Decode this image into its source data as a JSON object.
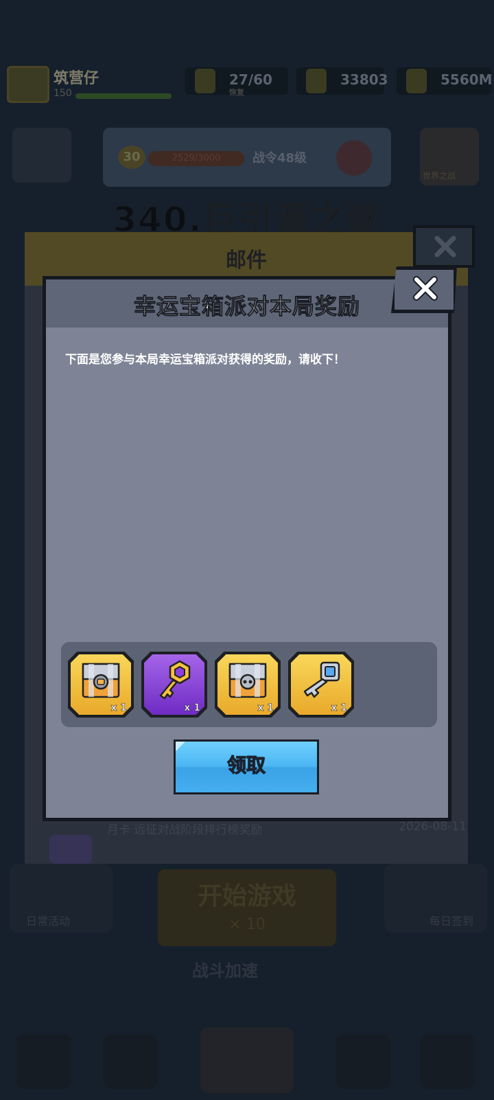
{
  "background": {
    "player_name": "筑营仔",
    "player_level": "150",
    "resources": [
      {
        "icon": "stamina-icon",
        "value": "27/60",
        "sub": "恢复"
      },
      {
        "icon": "gem-icon",
        "value": "33803"
      },
      {
        "icon": "coin-icon",
        "value": "5560M"
      }
    ],
    "banner": {
      "level": "30",
      "progress": "2529/3000",
      "text": "战令48级"
    },
    "side_right_label": "世界之战",
    "stage_title": "340.巨引源之谜",
    "mail": {
      "title": "邮件",
      "row_text": "月卡 远征对战阶段排行榜奖励",
      "row_date": "2026-08-11"
    },
    "bottom": {
      "left_label": "日常活动",
      "right_label": "每日签到",
      "start_label": "开始游戏",
      "start_cost": "× 10",
      "speed_label": "战斗加速"
    }
  },
  "dialog": {
    "title": "幸运宝箱派对本局奖励",
    "message": "下面是您参与本局幸运宝箱派对获得的奖励，请收下！",
    "rewards": [
      {
        "icon": "gold-chest-icon",
        "quantity": "x 1",
        "frame": "gold"
      },
      {
        "icon": "purple-key-icon",
        "quantity": "x 1",
        "frame": "purple"
      },
      {
        "icon": "silver-chest-icon",
        "quantity": "x 1",
        "frame": "gold"
      },
      {
        "icon": "silver-key-icon",
        "quantity": "x 1",
        "frame": "gold"
      }
    ],
    "claim_label": "领取"
  }
}
